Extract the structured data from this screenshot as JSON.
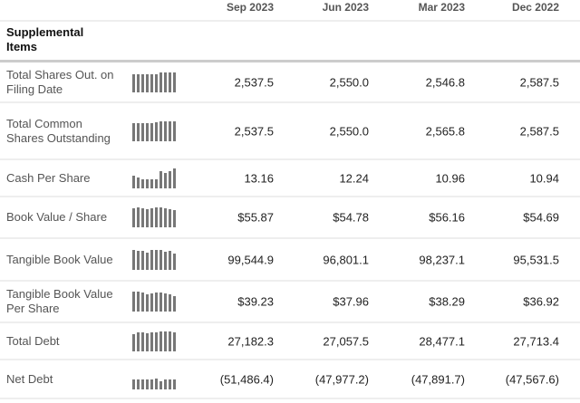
{
  "columns": [
    "Sep 2023",
    "Jun 2023",
    "Mar 2023",
    "Dec 2022"
  ],
  "section_title": "Supplemental Items",
  "rows": [
    {
      "label": "Total Shares Out. on Filing Date",
      "values": [
        "2,537.5",
        "2,550.0",
        "2,546.8",
        "2,587.5"
      ],
      "spark": [
        0.9,
        0.9,
        0.9,
        0.9,
        0.9,
        0.9,
        1,
        1,
        1,
        1
      ]
    },
    {
      "label": "Total Common Shares Outstanding",
      "values": [
        "2,537.5",
        "2,550.0",
        "2,565.8",
        "2,587.5"
      ],
      "spark": [
        0.9,
        0.9,
        0.9,
        0.9,
        0.9,
        0.95,
        1,
        1,
        1,
        1
      ]
    },
    {
      "label": "Cash Per Share",
      "values": [
        "13.16",
        "12.24",
        "10.96",
        "10.94"
      ],
      "spark": [
        0.62,
        0.55,
        0.45,
        0.45,
        0.45,
        0.45,
        0.85,
        0.75,
        0.85,
        1
      ]
    },
    {
      "label": "Book Value / Share",
      "values": [
        "$55.87",
        "$54.78",
        "$56.16",
        "$54.69"
      ],
      "spark": [
        0.95,
        1,
        0.95,
        0.9,
        0.95,
        1,
        1,
        0.95,
        0.9,
        0.85
      ]
    },
    {
      "label": "Tangible Book Value",
      "values": [
        "99,544.9",
        "96,801.1",
        "98,237.1",
        "95,531.5"
      ],
      "spark": [
        1,
        0.95,
        0.95,
        0.85,
        1,
        1,
        1,
        0.9,
        0.95,
        0.8
      ]
    },
    {
      "label": "Tangible Book Value Per Share",
      "values": [
        "$39.23",
        "$37.96",
        "$38.29",
        "$36.92"
      ],
      "spark": [
        1,
        1,
        0.95,
        0.85,
        0.9,
        0.95,
        0.95,
        0.9,
        0.85,
        0.75
      ]
    },
    {
      "label": "Total Debt",
      "values": [
        "27,182.3",
        "27,057.5",
        "28,477.1",
        "27,713.4"
      ],
      "spark": [
        0.85,
        0.95,
        0.95,
        0.9,
        0.95,
        0.95,
        1,
        1,
        1,
        0.95
      ]
    },
    {
      "label": "Net Debt",
      "values": [
        "(51,486.4)",
        "(47,977.2)",
        "(47,891.7)",
        "(47,567.6)"
      ],
      "spark": [
        0.5,
        0.5,
        0.5,
        0.5,
        0.5,
        0.55,
        0.42,
        0.5,
        0.5,
        0.5
      ]
    }
  ]
}
